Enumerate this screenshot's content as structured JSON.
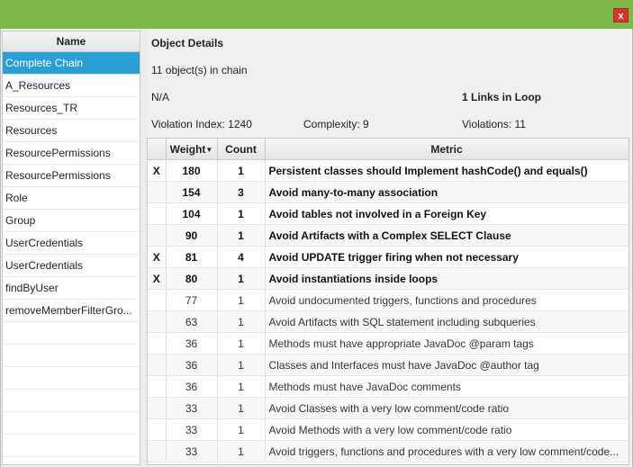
{
  "window": {
    "close_label": "x",
    "titlebar_color": "#7cb84a",
    "close_color": "#d9342b"
  },
  "left_list": {
    "header": "Name",
    "selected_color": "#2a9fd6",
    "items": [
      "Complete Chain",
      "A_Resources",
      "Resources_TR",
      "Resources",
      "ResourcePermissions",
      "ResourcePermissions",
      "Role",
      "Group",
      "UserCredentials",
      "UserCredentials",
      "findByUser",
      "removeMemberFilterGro..."
    ]
  },
  "details": {
    "title": "Object Details",
    "object_count": "11 object(s) in chain",
    "na": "N/A",
    "links_in_loop": "1 Links in Loop",
    "violation_index": "Violation Index: 1240",
    "complexity": "Complexity: 9",
    "violations": "Violations: 11"
  },
  "table": {
    "headers": {
      "x": "",
      "weight": "Weight",
      "count": "Count",
      "metric": "Metric"
    },
    "sort_icon": "sort-descending-icon",
    "rows": [
      {
        "x": "X",
        "weight": "180",
        "count": "1",
        "metric": "Persistent classes should Implement hashCode() and equals()",
        "bold": true
      },
      {
        "x": "",
        "weight": "154",
        "count": "3",
        "metric": "Avoid many-to-many association",
        "bold": true
      },
      {
        "x": "",
        "weight": "104",
        "count": "1",
        "metric": "Avoid tables not involved in a Foreign Key",
        "bold": true
      },
      {
        "x": "",
        "weight": "90",
        "count": "1",
        "metric": "Avoid Artifacts with a Complex SELECT Clause",
        "bold": true
      },
      {
        "x": "X",
        "weight": "81",
        "count": "4",
        "metric": "Avoid UPDATE trigger firing when not necessary",
        "bold": true
      },
      {
        "x": "X",
        "weight": "80",
        "count": "1",
        "metric": "Avoid instantiations inside loops",
        "bold": true
      },
      {
        "x": "",
        "weight": "77",
        "count": "1",
        "metric": "Avoid undocumented triggers, functions and procedures",
        "bold": false
      },
      {
        "x": "",
        "weight": "63",
        "count": "1",
        "metric": "Avoid Artifacts with SQL statement including subqueries",
        "bold": false
      },
      {
        "x": "",
        "weight": "36",
        "count": "1",
        "metric": "Methods must have appropriate JavaDoc @param tags",
        "bold": false
      },
      {
        "x": "",
        "weight": "36",
        "count": "1",
        "metric": "Classes and Interfaces must have JavaDoc @author tag",
        "bold": false
      },
      {
        "x": "",
        "weight": "36",
        "count": "1",
        "metric": "Methods must have JavaDoc comments",
        "bold": false
      },
      {
        "x": "",
        "weight": "33",
        "count": "1",
        "metric": "Avoid Classes with a very low comment/code ratio",
        "bold": false
      },
      {
        "x": "",
        "weight": "33",
        "count": "1",
        "metric": "Avoid Methods with a very low comment/code ratio",
        "bold": false
      },
      {
        "x": "",
        "weight": "33",
        "count": "1",
        "metric": "Avoid triggers, functions and procedures with a very low comment/code...",
        "bold": false
      }
    ]
  }
}
